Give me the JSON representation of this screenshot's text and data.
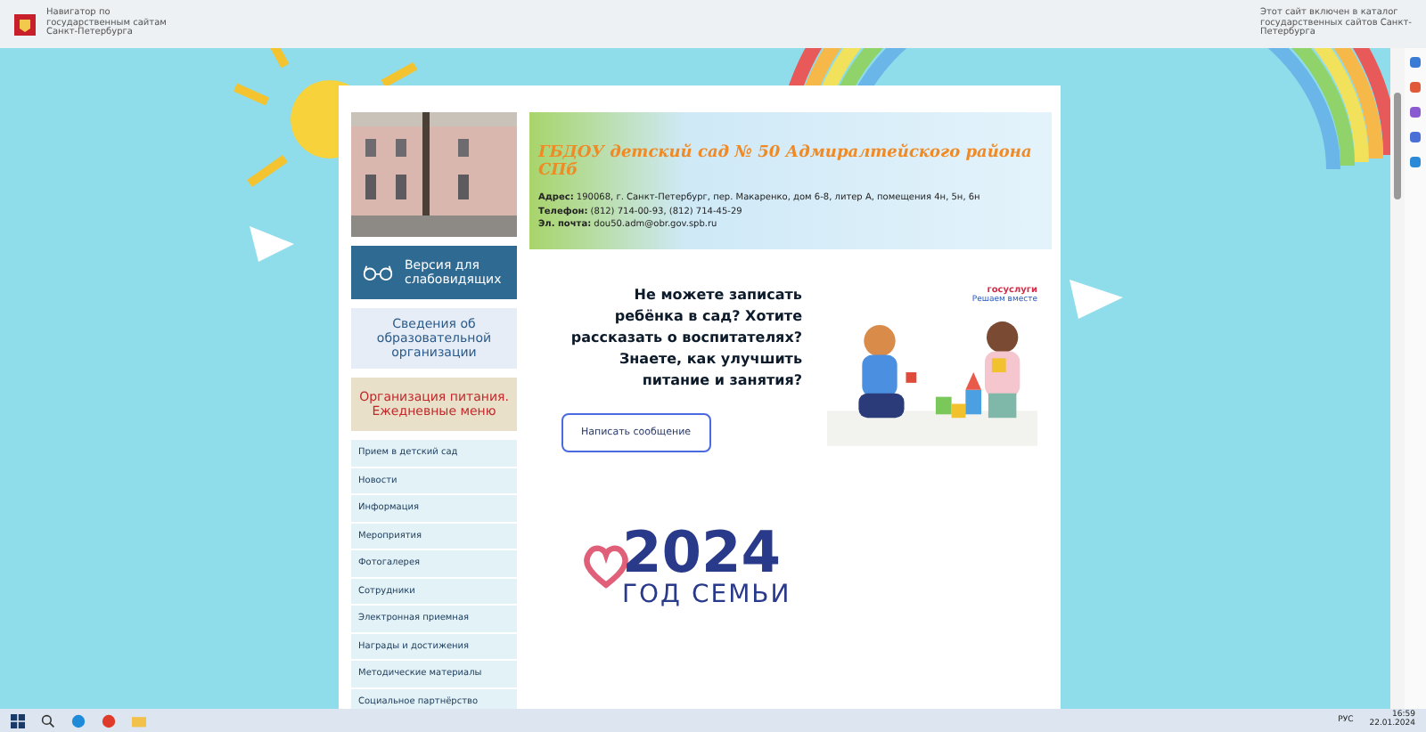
{
  "gov_bar": {
    "left_text": "Навигатор по государственным сайтам Санкт-Петербурга",
    "right_text": "Этот сайт включен в каталог государственных сайтов Санкт-Петербурга"
  },
  "sidebar": {
    "accessibility_button": "Версия для слабовидящих",
    "info_button": "Сведения об образовательной организации",
    "food_button": "Организация питания. Ежедневные меню",
    "menu": [
      {
        "label": "Прием в детский сад"
      },
      {
        "label": "Новости"
      },
      {
        "label": "Информация"
      },
      {
        "label": "Мероприятия"
      },
      {
        "label": "Фотогалерея"
      },
      {
        "label": "Сотрудники"
      },
      {
        "label": "Электронная приемная"
      },
      {
        "label": "Награды и достижения"
      },
      {
        "label": "Методические материалы"
      },
      {
        "label": "Социальное партнёрство"
      }
    ]
  },
  "header": {
    "title": "ГБДОУ детский сад № 50 Адмиралтейского района СПб",
    "details": [
      {
        "label": "Адрес:",
        "value": "190068, г. Санкт-Петербург, пер. Макаренко, дом 6-8, литер А, помещения 4н, 5н, 6н"
      },
      {
        "label": "Телефон:",
        "value": "(812) 714-00-93, (812) 714-45-29"
      },
      {
        "label": "Эл. почта:",
        "value": "dou50.adm@obr.gov.spb.ru"
      }
    ]
  },
  "promo": {
    "text": "Не можете записать ребёнка в сад? Хотите рассказать о воспитателях? Знаете, как улучшить питание и занятия?",
    "button": "Написать сообщение",
    "brand": "госуслуги",
    "brand_slogan": "Решаем вместе"
  },
  "year_logo": {
    "year": "2024",
    "caption": "ГОД СЕМЬИ"
  },
  "taskbar": {
    "language": "РУС",
    "time": "16:59",
    "date": "22.01.2024"
  }
}
